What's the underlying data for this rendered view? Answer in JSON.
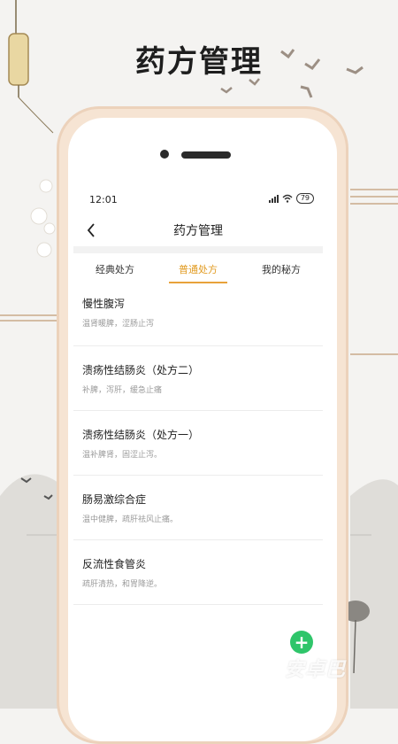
{
  "poster": {
    "title": "药方管理"
  },
  "status": {
    "time": "12:01",
    "battery": "79"
  },
  "nav": {
    "title": "药方管理"
  },
  "tabs": [
    {
      "label": "经典处方"
    },
    {
      "label": "普通处方"
    },
    {
      "label": "我的秘方"
    }
  ],
  "active_tab": "普通处方",
  "items": [
    {
      "title": "慢性腹泻",
      "desc": "温肾暖脾，涩肠止泻"
    },
    {
      "title": "溃疡性结肠炎（处方二）",
      "desc": "补脾，泻肝，缓急止痛"
    },
    {
      "title": "溃疡性结肠炎（处方一）",
      "desc": "温补脾肾，固涩止泻。"
    },
    {
      "title": "肠易激综合症",
      "desc": "温中健脾，疏肝祛风止痛。"
    },
    {
      "title": "反流性食管炎",
      "desc": "疏肝清热，和胃降逆。"
    }
  ],
  "fab": {
    "symbol": "+"
  },
  "watermark": "安卓巴",
  "colors": {
    "accent": "#e19a1f",
    "fab": "#2fc56a",
    "phone_frame": "#f6e4d3"
  },
  "icons": {
    "back": "chevron-left-icon",
    "add": "plus-icon",
    "wifi": "wifi-icon",
    "signal": "signal-icon"
  }
}
